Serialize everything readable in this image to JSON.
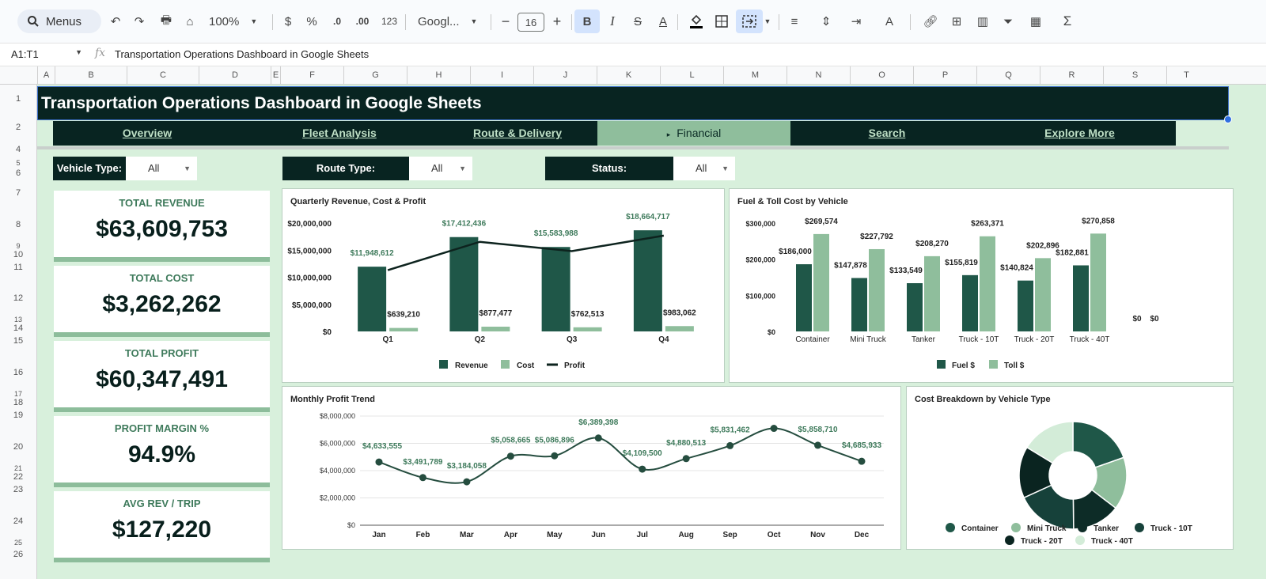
{
  "toolbar": {
    "menus_label": "Menus",
    "zoom": "100%",
    "currency": "$",
    "percent": "%",
    "dec_decrease": ".0",
    "dec_increase": ".00",
    "number_format": "123",
    "font": "Googl...",
    "font_size": "16"
  },
  "formula_bar": {
    "name_box": "A1:T1",
    "content": "Transportation Operations Dashboard in Google Sheets"
  },
  "columns": [
    "A",
    "B",
    "C",
    "D",
    "E",
    "F",
    "G",
    "H",
    "I",
    "J",
    "K",
    "L",
    "M",
    "N",
    "O",
    "P",
    "Q",
    "R",
    "S",
    "T"
  ],
  "rows": [
    "1",
    "2",
    "4",
    "5",
    "6",
    "7",
    "8",
    "9",
    "10",
    "11",
    "12",
    "13",
    "14",
    "15",
    "16",
    "17",
    "18",
    "19",
    "20",
    "21",
    "22",
    "23",
    "24",
    "25",
    "26"
  ],
  "dashboard": {
    "title": "Transportation Operations Dashboard in Google Sheets",
    "nav": [
      "Overview",
      "Fleet Analysis",
      "Route & Delivery",
      "Financial",
      "Search",
      "Explore More"
    ],
    "active_nav_marker": "▸",
    "filters": [
      {
        "label": "Vehicle Type:",
        "value": "All"
      },
      {
        "label": "Route Type:",
        "value": "All"
      },
      {
        "label": "Status:",
        "value": "All"
      }
    ],
    "kpis": [
      {
        "title": "TOTAL REVENUE",
        "value": "$63,609,753"
      },
      {
        "title": "TOTAL COST",
        "value": "$3,262,262"
      },
      {
        "title": "TOTAL PROFIT",
        "value": "$60,347,491"
      },
      {
        "title": "PROFIT MARGIN %",
        "value": "94.9%"
      },
      {
        "title": "AVG REV / TRIP",
        "value": "$127,220"
      }
    ]
  },
  "colors": {
    "dark": "#082421",
    "bar_dark": "#1f5748",
    "bar_light": "#8fbe9c",
    "sheet_bg": "#d8f0dc",
    "line": "#254d3f"
  },
  "chart_data": [
    {
      "type": "bar",
      "title": "Quarterly Revenue, Cost & Profit",
      "categories": [
        "Q1",
        "Q2",
        "Q3",
        "Q4"
      ],
      "series": [
        {
          "name": "Revenue",
          "values": [
            11948612,
            17412436,
            15583988,
            18664717
          ],
          "labels": [
            "$11,948,612",
            "$17,412,436",
            "$15,583,988",
            "$18,664,717"
          ]
        },
        {
          "name": "Cost",
          "values": [
            639210,
            877477,
            762513,
            983062
          ],
          "labels": [
            "$639,210",
            "$877,477",
            "$762,513",
            "$983,062"
          ]
        },
        {
          "name": "Profit",
          "type": "line",
          "values": [
            11309402,
            16534959,
            14821475,
            17681655
          ]
        }
      ],
      "yticks": [
        "$0",
        "$5,000,000",
        "$10,000,000",
        "$15,000,000",
        "$20,000,000"
      ],
      "ylim": [
        0,
        20000000
      ],
      "legend": "bottom"
    },
    {
      "type": "bar",
      "title": "Fuel & Toll Cost by Vehicle",
      "categories": [
        "Container",
        "Mini Truck",
        "Tanker",
        "Truck - 10T",
        "Truck - 20T",
        "Truck - 40T",
        ""
      ],
      "series": [
        {
          "name": "Fuel $",
          "values": [
            186000,
            147878,
            133549,
            155819,
            140824,
            182881,
            0
          ],
          "labels": [
            "$186,000",
            "$147,878",
            "$133,549",
            "$155,819",
            "$140,824",
            "$182,881",
            "$0"
          ]
        },
        {
          "name": "Toll $",
          "values": [
            269574,
            227792,
            208270,
            263371,
            202896,
            270858,
            0
          ],
          "labels": [
            "$269,574",
            "$227,792",
            "$208,270",
            "$263,371",
            "$202,896",
            "$270,858",
            "$0"
          ]
        }
      ],
      "yticks": [
        "$0",
        "$100,000",
        "$200,000",
        "$300,000"
      ],
      "ylim": [
        0,
        300000
      ],
      "legend": "bottom"
    },
    {
      "type": "line",
      "title": "Monthly Profit Trend",
      "categories": [
        "Jan",
        "Feb",
        "Mar",
        "Apr",
        "May",
        "Jun",
        "Jul",
        "Aug",
        "Sep",
        "Oct",
        "Nov",
        "Dec"
      ],
      "values": [
        4633555,
        3491789,
        3184058,
        5058665,
        5086896,
        6389398,
        4109500,
        4880513,
        5831462,
        7100000,
        5858710,
        4685933
      ],
      "labels": [
        "$4,633,555",
        "$3,491,789",
        "$3,184,058",
        "$5,058,665",
        "$5,086,896",
        "$6,389,398",
        "$4,109,500",
        "$4,880,513",
        "$5,831,462",
        "",
        "$5,858,710",
        "$4,685,933"
      ],
      "yticks": [
        "$0",
        "$2,000,000",
        "$4,000,000",
        "$6,000,000",
        "$8,000,000"
      ],
      "ylim": [
        0,
        8000000
      ]
    },
    {
      "type": "pie",
      "title": "Cost Breakdown by Vehicle Type",
      "categories": [
        "Container",
        "Mini Truck",
        "Tanker",
        "Truck - 10T",
        "Truck - 20T",
        "Truck - 40T"
      ],
      "values": [
        19.6,
        15.8,
        14.4,
        18.4,
        15.5,
        16.3
      ],
      "colors": [
        "#1f5748",
        "#8fbe9c",
        "#0d2c27",
        "#16413a",
        "#0a2420",
        "#d3ecd8"
      ],
      "legend": "bottom"
    }
  ]
}
